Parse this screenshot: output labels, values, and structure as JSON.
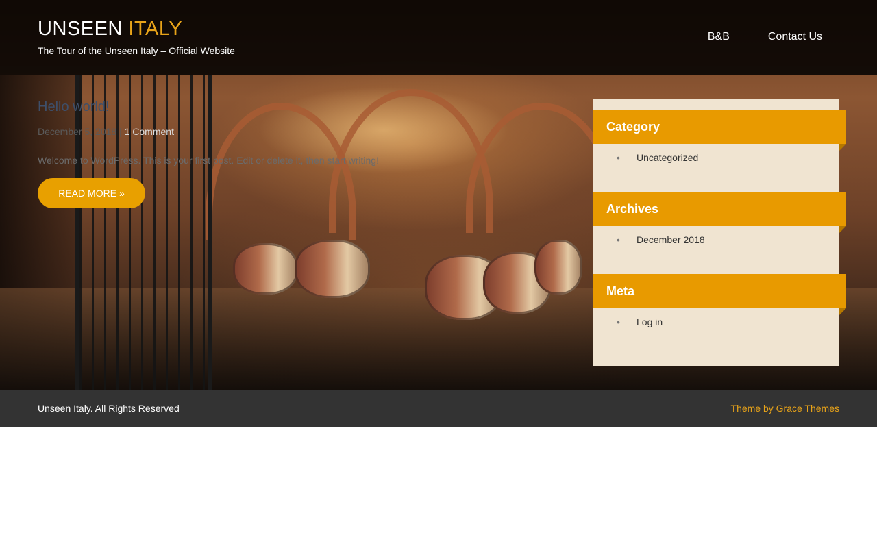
{
  "site": {
    "title_main": "UNSEEN",
    "title_accent": "ITALY",
    "tagline": "The Tour of the Unseen Italy – Official Website"
  },
  "nav": {
    "items": [
      {
        "label": "B&B"
      },
      {
        "label": "Contact Us"
      }
    ]
  },
  "post": {
    "title": "Hello world!",
    "date": "December 5, 2018",
    "comments": "1 Comment",
    "excerpt": "Welcome to WordPress. This is your first post. Edit or delete it, then start writing!",
    "read_more": "READ MORE »"
  },
  "sidebar": {
    "widgets": [
      {
        "title": "Category",
        "items": [
          "Uncategorized"
        ]
      },
      {
        "title": "Archives",
        "items": [
          "December 2018"
        ]
      },
      {
        "title": "Meta",
        "items": [
          "Log in"
        ]
      }
    ]
  },
  "footer": {
    "copyright": "Unseen Italy. All Rights Reserved",
    "credit": "Theme by Grace Themes"
  },
  "colors": {
    "accent": "#e8a000",
    "sidebar_bg": "#f0e4d1",
    "footer_bg": "#333333"
  }
}
